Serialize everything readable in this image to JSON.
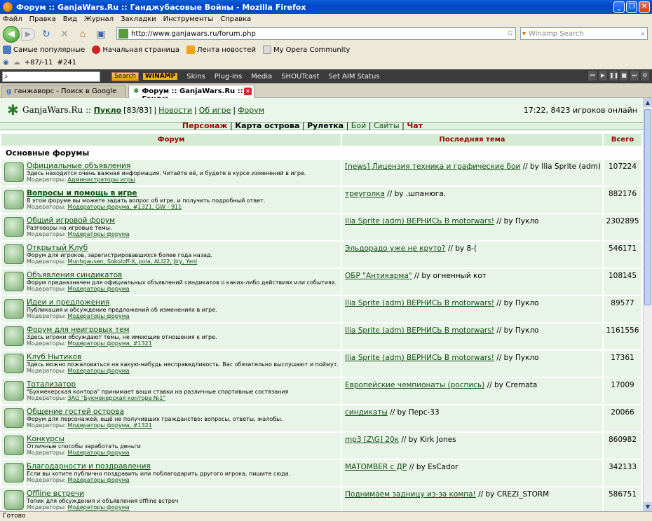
{
  "window": {
    "title": "Форум :: GanjaWars.Ru :: Ганджубасовые Войны - Mozilla Firefox"
  },
  "menu": [
    "Файл",
    "Правка",
    "Вид",
    "Журнал",
    "Закладки",
    "Инструменты",
    "Справка"
  ],
  "nav": {
    "url": "http://www.ganjawars.ru/forum.php",
    "search_placeholder": "Winamp Search"
  },
  "bookmarks": [
    "Самые популярные",
    "Начальная страница",
    "Лента новостей",
    "My Opera Community"
  ],
  "status_row": {
    "temp": "+87/-11",
    "num": "#241"
  },
  "winamp": {
    "find_label": "Search",
    "logo": "WINAMP",
    "items": [
      "Skins",
      "Plug-ins",
      "Media",
      "SHOUTcast",
      "Set AIM Status"
    ]
  },
  "tabs": [
    {
      "label": "ганжаворс - Поиск в Google"
    },
    {
      "label": "Форум :: GanjaWars.Ru :: Гандж..."
    }
  ],
  "site": {
    "name": "GanjaWars.Ru",
    "sep": "::",
    "user": "Пукло",
    "level": "[83/83]",
    "links": [
      "Новости",
      "Об игре",
      "Форум"
    ],
    "online": "17:22, 8423 игроков онлайн"
  },
  "subnav": [
    "Персонаж",
    "Карта острова",
    "Рулетка",
    "Бой",
    "Сайты",
    "Чат"
  ],
  "table": {
    "headers": [
      "Форум",
      "Последняя тема",
      "Всего"
    ],
    "section": "Основные форумы",
    "rows": [
      {
        "title": "Официальные объявления",
        "desc": "Здесь находится очень важная информация. Читайте её, и будете в курсе изменений в игре.",
        "mods_label": "Модераторы:",
        "mods": "Администраторы игры",
        "topic": "[news] Лицензия техника и графические бои",
        "by": " // by Ilia Sprite (adm)",
        "count": "107224"
      },
      {
        "title": "Вопросы и помощь в игре",
        "desc": "В этом форуме вы можете задать вопрос об игре, и получить подробный ответ.",
        "mods_label": "Модераторы:",
        "mods": "Модераторы форума, #1321, GW - 911",
        "topic": "треуголка",
        "by": " // by .шпанюга.",
        "count": "882176"
      },
      {
        "title": "Общий игровой форум",
        "desc": "Разговоры на игровые темы.",
        "mods_label": "Модераторы:",
        "mods": "Модераторы форума",
        "topic": "Ilia Sprite (adm) ВЕРНИСЬ В motorwars!",
        "by": " // by Пукло",
        "count": "2302895"
      },
      {
        "title": "Открытый Клуб",
        "desc": "Форум для игроков, зарегистрировавшихся более года назад.",
        "mods_label": "Модераторы:",
        "mods": "Munhgausen, Sokoloff-X, pola, ALI22, Jiry, Yeni",
        "topic": "Эльдорадо уже не круто?",
        "by": " // by 8-(",
        "count": "546171"
      },
      {
        "title": "Объявления синдикатов",
        "desc": "Форум предназначен для официальных объявлений синдикатов о каких-либо действиях или событиях.",
        "mods_label": "Модераторы:",
        "mods": "Модераторы форума",
        "topic": "ОБР \"Антикарма\"",
        "by": " // by огненный кот",
        "count": "108145"
      },
      {
        "title": "Идеи и предложения",
        "desc": "Публикация и обсуждение предложений об изменениях в игре.",
        "mods_label": "Модераторы:",
        "mods": "Модераторы форума",
        "topic": "Ilia Sprite (adm) ВЕРНИСЬ В motorwars!",
        "by": " // by Пукло",
        "count": "89577"
      },
      {
        "title": "Форум для неигровых тем",
        "desc": "Здесь игроки обсуждают темы, не имеющие отношения к игре.",
        "mods_label": "Модераторы:",
        "mods": "Модераторы форума, #1321",
        "topic": "Ilia Sprite (adm) ВЕРНИСЬ В motorwars!",
        "by": " // by Пукло",
        "count": "1161556"
      },
      {
        "title": "Клуб Нытиков",
        "desc": "Здесь можно пожаловаться на какую-нибудь несправедливость. Вас обязательно выслушают и поймут.",
        "mods_label": "Модераторы:",
        "mods": "Модераторы форума",
        "topic": "Ilia Sprite (adm) ВЕРНИСЬ В motorwars!",
        "by": " // by Пукло",
        "count": "17361"
      },
      {
        "title": "Тотализатор",
        "desc": "\"Букмекерская контора\" принимает ваши ставки на различные спортивные состязания",
        "mods_label": "Модераторы:",
        "mods": "ЗАО \"Букмекерская контора №1\"",
        "topic": "Европейские чемпионаты (роспись)",
        "by": " // by Cremata",
        "count": "17009"
      },
      {
        "title": "Общение гостей острова",
        "desc": "Форум для персонажей, ещё не получивших гражданство: вопросы, ответы, жалобы.",
        "mods_label": "Модераторы:",
        "mods": "Модераторы форума, #1321",
        "topic": "синдикаты",
        "by": " // by Перс-33",
        "count": "20066"
      },
      {
        "title": "Конкурсы",
        "desc": "Отличные способы заработать деньги",
        "mods_label": "Модераторы:",
        "mods": "Модераторы форума",
        "topic": "mp3 [Z\\G] 20к",
        "by": " // by Kirk Jones",
        "count": "860982"
      },
      {
        "title": "Благодарности и поздравления",
        "desc": "Если вы хотите публично поздравить или поблагодарить другого игрока, пишите сюда.",
        "mods_label": "Модераторы:",
        "mods": "Модераторы форума",
        "topic": "МАТОМВЕR с ДР",
        "by": " // by EsCador",
        "count": "342133"
      },
      {
        "title": "Offline встречи",
        "desc": "Топик для обсуждения и объявления offline встреч",
        "mods_label": "Модераторы:",
        "mods": "Модераторы форума",
        "topic": "Поднимаем задницу из-за компа!",
        "by": " // by CREZI_STORM",
        "count": "586751"
      }
    ]
  },
  "statusbar": {
    "text": "Готово"
  }
}
